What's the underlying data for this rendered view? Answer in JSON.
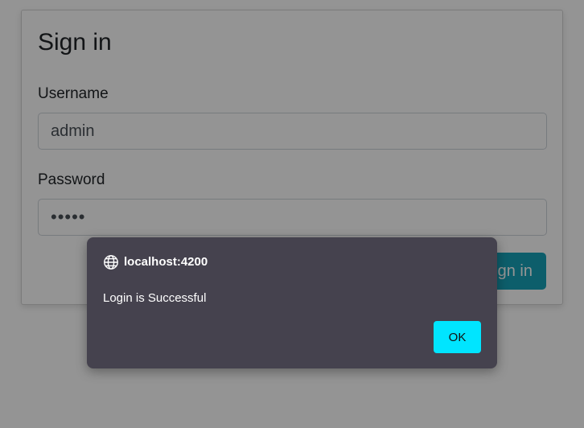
{
  "signin_form": {
    "title": "Sign in",
    "username_label": "Username",
    "username_value": "admin",
    "password_label": "Password",
    "password_value": "•••••",
    "submit_label": "Sign in"
  },
  "alert_dialog": {
    "origin": "localhost:4200",
    "origin_icon": "globe-icon",
    "message": "Login is Successful",
    "ok_label": "OK"
  },
  "colors": {
    "primary_button": "#17a2b8",
    "dialog_background": "#45424e",
    "ok_button": "#00e5ff"
  }
}
